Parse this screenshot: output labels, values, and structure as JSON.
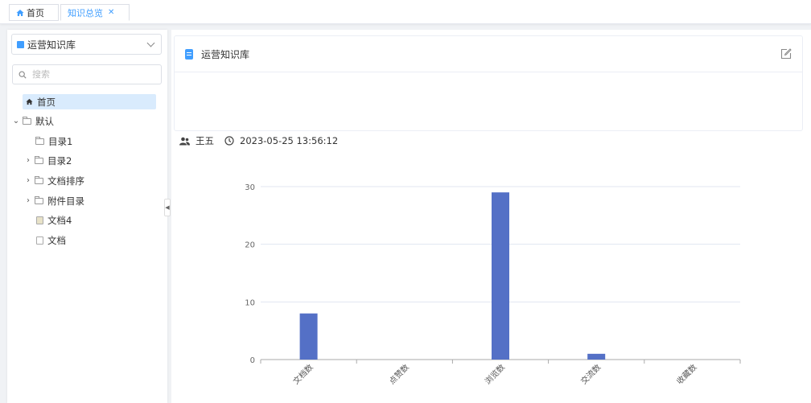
{
  "tabs": [
    {
      "label": "首页",
      "icon": "home-icon",
      "active": false
    },
    {
      "label": "知识总览",
      "icon": "",
      "active": true
    }
  ],
  "sidebar": {
    "kb_select": {
      "value": "运营知识库"
    },
    "search": {
      "placeholder": "搜索"
    },
    "tree": [
      {
        "label": "首页",
        "type": "home",
        "level": 0,
        "selected": true
      },
      {
        "label": "默认",
        "type": "folder",
        "level": 0,
        "expanded": true
      },
      {
        "label": "目录1",
        "type": "folder",
        "level": 1
      },
      {
        "label": "目录2",
        "type": "folder",
        "level": 1,
        "expandable": true
      },
      {
        "label": "文档排序",
        "type": "folder",
        "level": 1,
        "expandable": true
      },
      {
        "label": "附件目录",
        "type": "folder",
        "level": 1,
        "expandable": true
      },
      {
        "label": "文档4",
        "type": "doc",
        "level": 1
      },
      {
        "label": "文档",
        "type": "doc",
        "level": 1
      }
    ]
  },
  "main": {
    "kb_title": "运营知识库",
    "author": "王五",
    "timestamp": "2023-05-25 13:56:12"
  },
  "chart_data": {
    "type": "bar",
    "categories": [
      "文档数",
      "点赞数",
      "浏览数",
      "交流数",
      "收藏数"
    ],
    "values": [
      8,
      0,
      29,
      1,
      0
    ],
    "ylim": [
      0,
      30
    ],
    "yticks": [
      0,
      10,
      20,
      30
    ],
    "color": "#5470c6",
    "grid": true
  },
  "colors": {
    "accent": "#409eff",
    "bar": "#5470c6",
    "selected_bg": "#d9ebfd"
  }
}
